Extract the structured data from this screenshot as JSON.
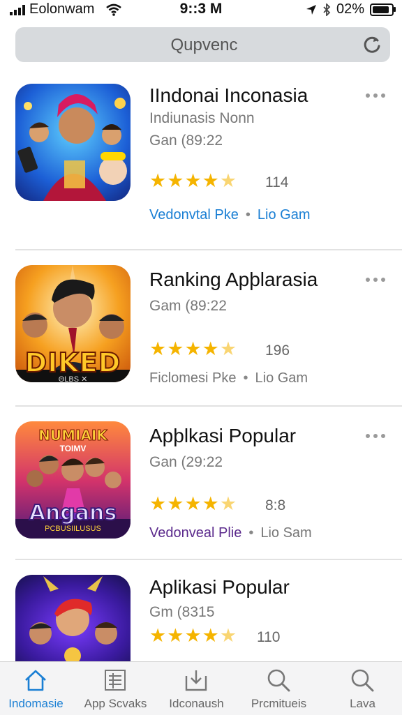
{
  "status_bar": {
    "carrier": "Eolonwam",
    "time": "9::3 M",
    "battery": "02%",
    "battery_level": 0.9
  },
  "search": {
    "placeholder": "Qupvenc"
  },
  "apps": [
    {
      "title": "IIndonai Inconasia",
      "subtitle": "Indiunasis Nonn",
      "meta": "Gan (89:22",
      "rating": 4.5,
      "count": "114",
      "link1": "Vedonvtal Pke",
      "link2": "Lio Gam",
      "link_color": "#1a7fd4"
    },
    {
      "title": "Ranking Apþlarasia",
      "subtitle": "",
      "meta": "Gam (89:22",
      "rating": 4.5,
      "count": "196",
      "link1": "Ficlomesi Pke",
      "link2": "Lio Gam",
      "link_color": "#777777",
      "icon_text": "DIKED",
      "icon_small": "ΘLBS ✕"
    },
    {
      "title": "Apþlkasi Popular",
      "subtitle": "",
      "meta": "Gan (29:22",
      "rating": 4.5,
      "count": "8:8",
      "link1": "Vedonveal Plie",
      "link2": "Lio Sam",
      "link_color": "#5b2a8c",
      "icon_top": "NUMIAIK",
      "icon_top2": "TOIMV",
      "icon_text": "Angans",
      "icon_small": "PCBUSIILUSUS"
    },
    {
      "title": "Aplikasi Popular",
      "subtitle": "",
      "meta": "Gm (8315",
      "rating": 4.5,
      "count": "110",
      "link1": "",
      "link2": "",
      "link_color": "#777777"
    }
  ],
  "tabs": [
    {
      "label": "Indomasie",
      "icon": "home-icon",
      "active": true
    },
    {
      "label": "App Scvaks",
      "icon": "list-icon",
      "active": false
    },
    {
      "label": "Idconaush",
      "icon": "download-icon",
      "active": false
    },
    {
      "label": "Prcmitueis",
      "icon": "search-icon",
      "active": false
    },
    {
      "label": "Lava",
      "icon": "search-icon",
      "active": false
    }
  ]
}
